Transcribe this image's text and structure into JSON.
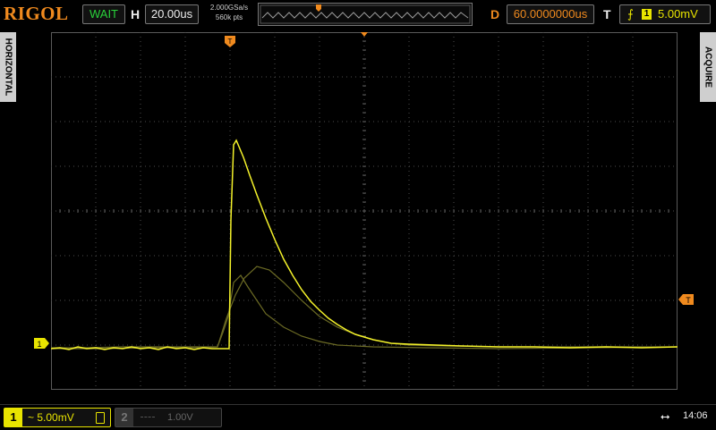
{
  "brand": "RIGOL",
  "status": "WAIT",
  "horizontal": {
    "label": "H",
    "timebase": "20.00us",
    "sample_rate": "2.000GSa/s",
    "memory_depth": "560k pts"
  },
  "delay": {
    "label": "D",
    "value": "60.0000000us"
  },
  "trigger": {
    "label": "T",
    "source": "1",
    "level": "5.00mV"
  },
  "side_tabs": {
    "left": "HORIZONTAL",
    "right": "ACQUIRE"
  },
  "markers": {
    "trigger_pos": "T",
    "channel1": "1"
  },
  "channels": [
    {
      "num": "1",
      "coupling": "~",
      "scale": "5.00mV",
      "color": "#e8e400",
      "active": true
    },
    {
      "num": "2",
      "coupling": "",
      "scale": "1.00V",
      "color": "#5a5a5a",
      "active": false
    }
  ],
  "clock": "14:06",
  "colors": {
    "trace": "#f4f22a",
    "persist": "#6b6a24",
    "grid": "#4b4b4b",
    "accent": "#f08a1e",
    "status": "#29d13a"
  }
}
